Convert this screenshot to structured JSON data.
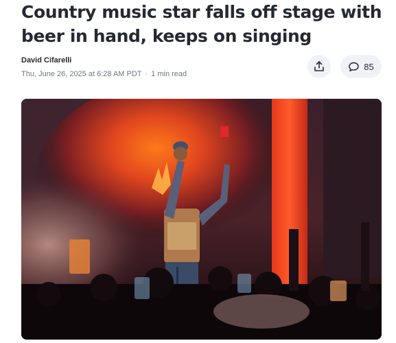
{
  "article": {
    "headline": "Country music star falls off stage with beer in hand, keeps on singing",
    "author": "David Cifarelli",
    "date": "Thu, June 26, 2025 at 6:28 AM PDT",
    "read_time": "1 min read"
  },
  "actions": {
    "share_icon": "share-icon",
    "comment_icon": "comment-icon",
    "comment_count": "85"
  },
  "image": {
    "subject": "performer-on-stage-photo"
  }
}
